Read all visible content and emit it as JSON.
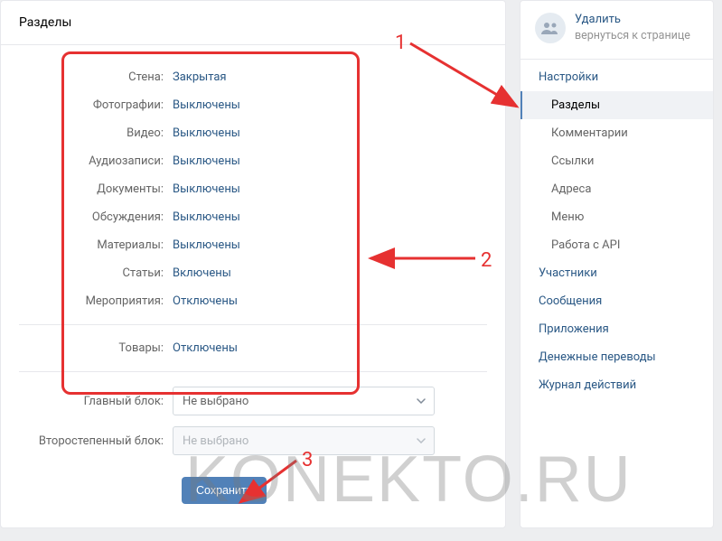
{
  "header": {
    "title": "Разделы"
  },
  "settings": [
    {
      "label": "Стена:",
      "value": "Закрытая"
    },
    {
      "label": "Фотографии:",
      "value": "Выключены"
    },
    {
      "label": "Видео:",
      "value": "Выключены"
    },
    {
      "label": "Аудиозаписи:",
      "value": "Выключены"
    },
    {
      "label": "Документы:",
      "value": "Выключены"
    },
    {
      "label": "Обсуждения:",
      "value": "Выключены"
    },
    {
      "label": "Материалы:",
      "value": "Выключены"
    },
    {
      "label": "Статьи:",
      "value": "Включены"
    },
    {
      "label": "Мероприятия:",
      "value": "Отключены"
    }
  ],
  "goods": {
    "label": "Товары:",
    "value": "Отключены"
  },
  "blocks": {
    "main": {
      "label": "Главный блок:",
      "value": "Не выбрано"
    },
    "secondary": {
      "label": "Второстепенный блок:",
      "value": "Не выбрано"
    }
  },
  "save": {
    "label": "Сохранить"
  },
  "sidebarHeader": {
    "title": "Удалить",
    "subtitle": "вернуться к странице"
  },
  "sidebar": {
    "settings": "Настройки",
    "sections": "Разделы",
    "comments": "Комментарии",
    "links": "Ссылки",
    "addresses": "Адреса",
    "menu": "Меню",
    "api": "Работа с API",
    "members": "Участники",
    "messages": "Сообщения",
    "apps": "Приложения",
    "money": "Денежные переводы",
    "log": "Журнал действий"
  },
  "annotations": {
    "n1": "1",
    "n2": "2",
    "n3": "3"
  },
  "watermark": "KONEKTO.RU"
}
